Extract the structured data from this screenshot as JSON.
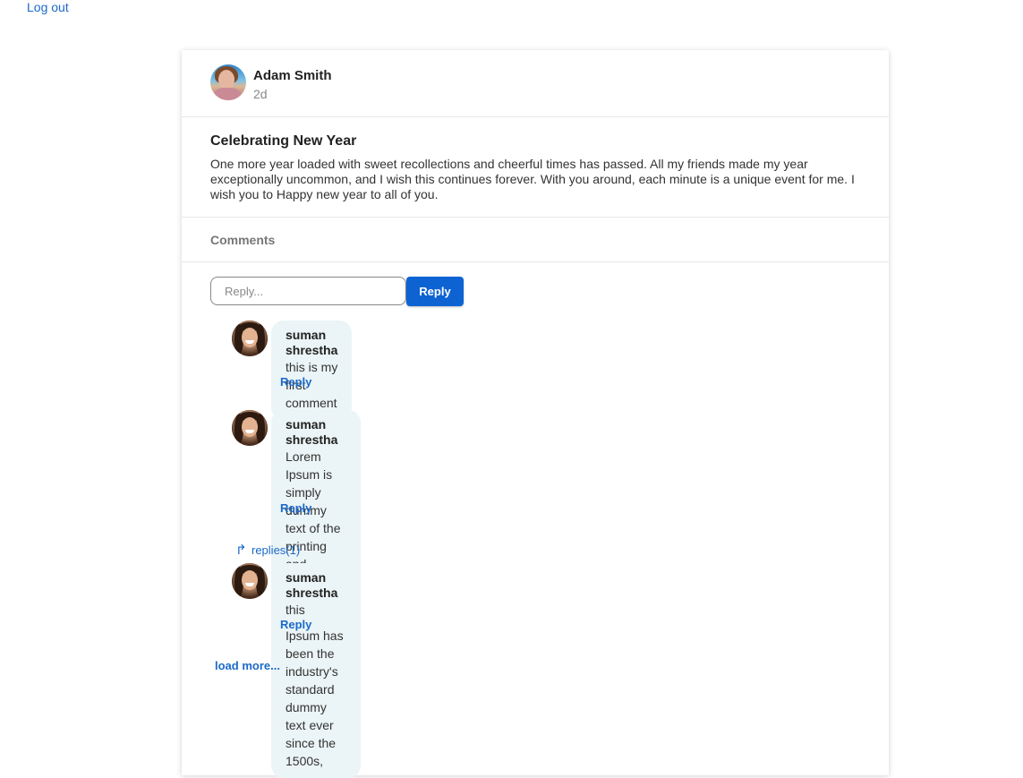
{
  "nav": {
    "logout_label": "Log out"
  },
  "post": {
    "author": "Adam Smith",
    "time": "2d",
    "title": "Celebrating New Year",
    "body": "One more year loaded with sweet recollections and cheerful times has passed. All my friends made my year exceptionally uncommon, and I wish this continues forever. With you around, each minute is a unique event for me. I wish you to Happy new year to all of you."
  },
  "comments_section": {
    "label": "Comments",
    "input_placeholder": "Reply...",
    "submit_label": "Reply",
    "comments": [
      {
        "author": "suman shrestha",
        "text": "this is my first comment",
        "reply_label": "Reply"
      },
      {
        "author": "suman shrestha",
        "text": "Lorem Ipsum is simply dummy text of the printing and\ntypesetting industry. Lorem Ipsum has been the industry's\nstandard dummy text ever since the 1500s,",
        "reply_label": "Reply",
        "replies_toggle": "replies(1)",
        "replies": [
          {
            "author": "suman shrestha",
            "text": "this",
            "reply_label": "Reply"
          }
        ]
      }
    ],
    "load_more_label": "load more..."
  },
  "colors": {
    "accent": "#0e63d3",
    "link": "#1b6ac9",
    "bubble": "#ebf4f6"
  }
}
